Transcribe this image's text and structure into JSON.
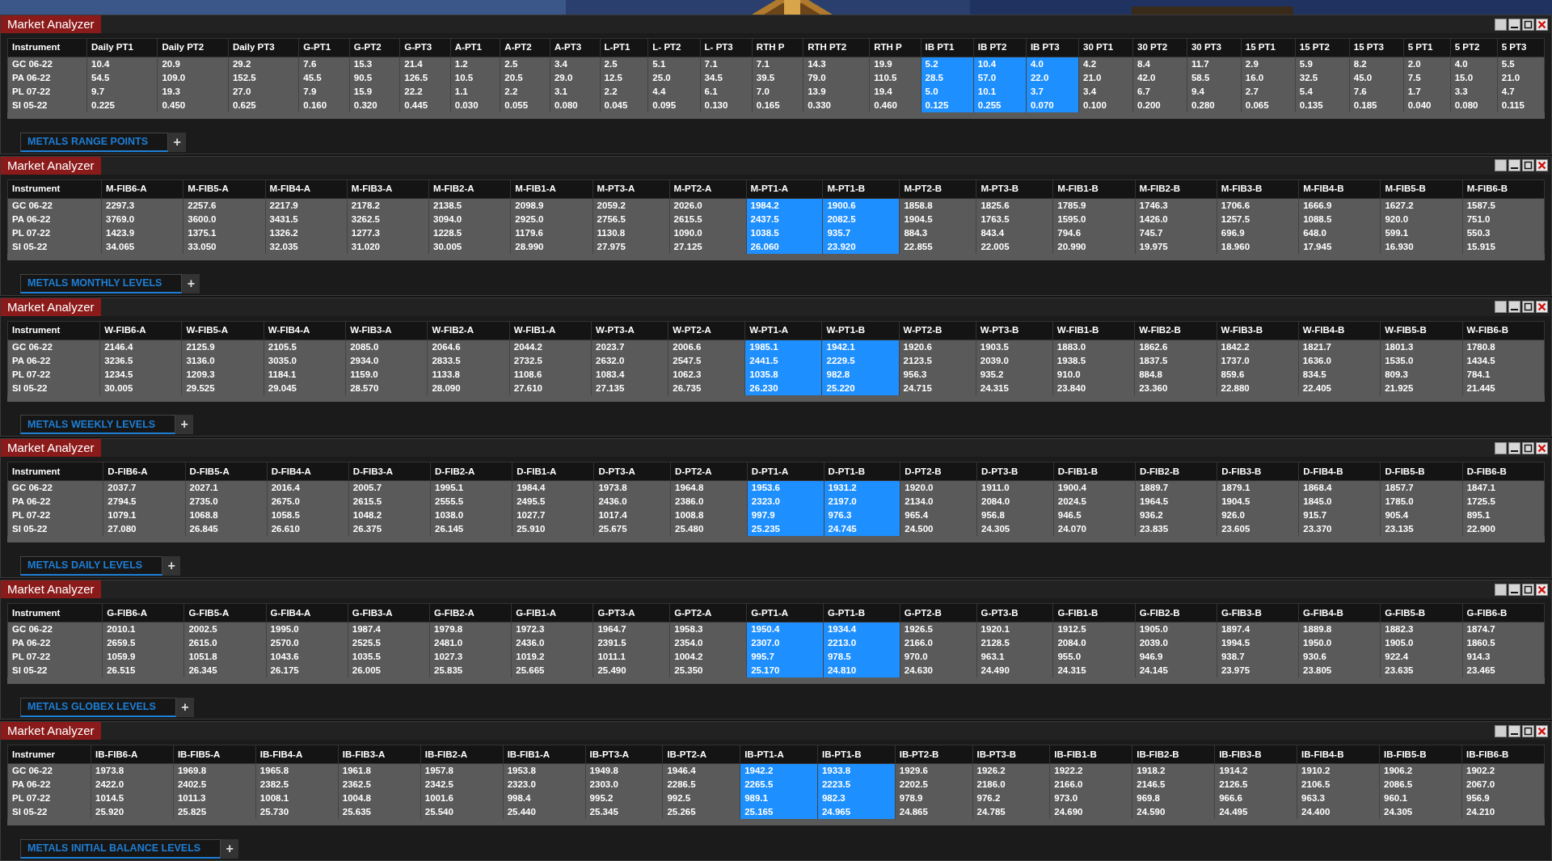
{
  "panels": [
    {
      "title": "Market Analyzer",
      "instrument_header": "Instrument",
      "tab": "METALS RANGE POINTS",
      "add_tab": "+",
      "columns": [
        {
          "label": "Daily PT1",
          "highlighted": false
        },
        {
          "label": "Daily PT2",
          "highlighted": false
        },
        {
          "label": "Daily PT3",
          "highlighted": false
        },
        {
          "label": "G-PT1",
          "highlighted": false
        },
        {
          "label": "G-PT2",
          "highlighted": false
        },
        {
          "label": "G-PT3",
          "highlighted": false
        },
        {
          "label": "A-PT1",
          "highlighted": false
        },
        {
          "label": "A-PT2",
          "highlighted": false
        },
        {
          "label": "A-PT3",
          "highlighted": false
        },
        {
          "label": "L-PT1",
          "highlighted": false
        },
        {
          "label": "L- PT2",
          "highlighted": false
        },
        {
          "label": "L- PT3",
          "highlighted": false
        },
        {
          "label": "RTH P",
          "highlighted": false
        },
        {
          "label": "RTH PT2",
          "highlighted": false
        },
        {
          "label": "RTH P",
          "highlighted": false
        },
        {
          "label": "IB PT1",
          "highlighted": true
        },
        {
          "label": "IB PT2",
          "highlighted": true
        },
        {
          "label": "IB PT3",
          "highlighted": true
        },
        {
          "label": "30 PT1",
          "highlighted": false
        },
        {
          "label": "30 PT2",
          "highlighted": false
        },
        {
          "label": "30 PT3",
          "highlighted": false
        },
        {
          "label": "15 PT1",
          "highlighted": false
        },
        {
          "label": "15 PT2",
          "highlighted": false
        },
        {
          "label": "15 PT3",
          "highlighted": false
        },
        {
          "label": "5 PT1",
          "highlighted": false
        },
        {
          "label": "5 PT2",
          "highlighted": false
        },
        {
          "label": "5 PT3",
          "highlighted": false
        }
      ],
      "rows": [
        {
          "instrument": "GC 06-22",
          "values": [
            "10.4",
            "20.9",
            "29.2",
            "7.6",
            "15.3",
            "21.4",
            "1.2",
            "2.5",
            "3.4",
            "2.5",
            "5.1",
            "7.1",
            "7.1",
            "14.3",
            "19.9",
            "5.2",
            "10.4",
            "4.0",
            "4.2",
            "8.4",
            "11.7",
            "2.9",
            "5.9",
            "8.2",
            "2.0",
            "4.0",
            "5.5"
          ]
        },
        {
          "instrument": "PA 06-22",
          "values": [
            "54.5",
            "109.0",
            "152.5",
            "45.5",
            "90.5",
            "126.5",
            "10.5",
            "20.5",
            "29.0",
            "12.5",
            "25.0",
            "34.5",
            "39.5",
            "79.0",
            "110.5",
            "28.5",
            "57.0",
            "22.0",
            "21.0",
            "42.0",
            "58.5",
            "16.0",
            "32.5",
            "45.0",
            "7.5",
            "15.0",
            "21.0"
          ]
        },
        {
          "instrument": "PL 07-22",
          "values": [
            "9.7",
            "19.3",
            "27.0",
            "7.9",
            "15.9",
            "22.2",
            "1.1",
            "2.2",
            "3.1",
            "2.2",
            "4.4",
            "6.1",
            "7.0",
            "13.9",
            "19.4",
            "5.0",
            "10.1",
            "3.7",
            "3.4",
            "6.7",
            "9.4",
            "2.7",
            "5.4",
            "7.6",
            "1.7",
            "3.3",
            "4.7"
          ]
        },
        {
          "instrument": "SI 05-22",
          "values": [
            "0.225",
            "0.450",
            "0.625",
            "0.160",
            "0.320",
            "0.445",
            "0.030",
            "0.055",
            "0.080",
            "0.045",
            "0.095",
            "0.130",
            "0.165",
            "0.330",
            "0.460",
            "0.125",
            "0.255",
            "0.070",
            "0.100",
            "0.200",
            "0.280",
            "0.065",
            "0.135",
            "0.185",
            "0.040",
            "0.080",
            "0.115"
          ]
        }
      ]
    },
    {
      "title": "Market Analyzer",
      "instrument_header": "Instrument",
      "tab": "METALS MONTHLY LEVELS",
      "add_tab": "+",
      "columns": [
        {
          "label": "M-FIB6-A",
          "highlighted": false
        },
        {
          "label": "M-FIB5-A",
          "highlighted": false
        },
        {
          "label": "M-FIB4-A",
          "highlighted": false
        },
        {
          "label": "M-FIB3-A",
          "highlighted": false
        },
        {
          "label": "M-FIB2-A",
          "highlighted": false
        },
        {
          "label": "M-FIB1-A",
          "highlighted": false
        },
        {
          "label": "M-PT3-A",
          "highlighted": false
        },
        {
          "label": "M-PT2-A",
          "highlighted": false
        },
        {
          "label": "M-PT1-A",
          "highlighted": true
        },
        {
          "label": "M-PT1-B",
          "highlighted": true
        },
        {
          "label": "M-PT2-B",
          "highlighted": false
        },
        {
          "label": "M-PT3-B",
          "highlighted": false
        },
        {
          "label": "M-FIB1-B",
          "highlighted": false
        },
        {
          "label": "M-FIB2-B",
          "highlighted": false
        },
        {
          "label": "M-FIB3-B",
          "highlighted": false
        },
        {
          "label": "M-FIB4-B",
          "highlighted": false
        },
        {
          "label": "M-FIB5-B",
          "highlighted": false
        },
        {
          "label": "M-FIB6-B",
          "highlighted": false
        }
      ],
      "rows": [
        {
          "instrument": "GC 06-22",
          "values": [
            "2297.3",
            "2257.6",
            "2217.9",
            "2178.2",
            "2138.5",
            "2098.9",
            "2059.2",
            "2026.0",
            "1984.2",
            "1900.6",
            "1858.8",
            "1825.6",
            "1785.9",
            "1746.3",
            "1706.6",
            "1666.9",
            "1627.2",
            "1587.5"
          ]
        },
        {
          "instrument": "PA 06-22",
          "values": [
            "3769.0",
            "3600.0",
            "3431.5",
            "3262.5",
            "3094.0",
            "2925.0",
            "2756.5",
            "2615.5",
            "2437.5",
            "2082.5",
            "1904.5",
            "1763.5",
            "1595.0",
            "1426.0",
            "1257.5",
            "1088.5",
            "920.0",
            "751.0"
          ]
        },
        {
          "instrument": "PL 07-22",
          "values": [
            "1423.9",
            "1375.1",
            "1326.2",
            "1277.3",
            "1228.5",
            "1179.6",
            "1130.8",
            "1090.0",
            "1038.5",
            "935.7",
            "884.3",
            "843.4",
            "794.6",
            "745.7",
            "696.9",
            "648.0",
            "599.1",
            "550.3"
          ]
        },
        {
          "instrument": "SI 05-22",
          "values": [
            "34.065",
            "33.050",
            "32.035",
            "31.020",
            "30.005",
            "28.990",
            "27.975",
            "27.125",
            "26.060",
            "23.920",
            "22.855",
            "22.005",
            "20.990",
            "19.975",
            "18.960",
            "17.945",
            "16.930",
            "15.915"
          ]
        }
      ]
    },
    {
      "title": "Market Analyzer",
      "instrument_header": "Instrument",
      "tab": "METALS WEEKLY LEVELS",
      "add_tab": "+",
      "columns": [
        {
          "label": "W-FIB6-A",
          "highlighted": false
        },
        {
          "label": "W-FIB5-A",
          "highlighted": false
        },
        {
          "label": "W-FIB4-A",
          "highlighted": false
        },
        {
          "label": "W-FIB3-A",
          "highlighted": false
        },
        {
          "label": "W-FIB2-A",
          "highlighted": false
        },
        {
          "label": "W-FIB1-A",
          "highlighted": false
        },
        {
          "label": "W-PT3-A",
          "highlighted": false
        },
        {
          "label": "W-PT2-A",
          "highlighted": false
        },
        {
          "label": "W-PT1-A",
          "highlighted": true
        },
        {
          "label": "W-PT1-B",
          "highlighted": true
        },
        {
          "label": "W-PT2-B",
          "highlighted": false
        },
        {
          "label": "W-PT3-B",
          "highlighted": false
        },
        {
          "label": "W-FIB1-B",
          "highlighted": false
        },
        {
          "label": "W-FIB2-B",
          "highlighted": false
        },
        {
          "label": "W-FIB3-B",
          "highlighted": false
        },
        {
          "label": "W-FIB4-B",
          "highlighted": false
        },
        {
          "label": "W-FIB5-B",
          "highlighted": false
        },
        {
          "label": "W-FIB6-B",
          "highlighted": false
        }
      ],
      "rows": [
        {
          "instrument": "GC 06-22",
          "values": [
            "2146.4",
            "2125.9",
            "2105.5",
            "2085.0",
            "2064.6",
            "2044.2",
            "2023.7",
            "2006.6",
            "1985.1",
            "1942.1",
            "1920.6",
            "1903.5",
            "1883.0",
            "1862.6",
            "1842.2",
            "1821.7",
            "1801.3",
            "1780.8"
          ]
        },
        {
          "instrument": "PA 06-22",
          "values": [
            "3236.5",
            "3136.0",
            "3035.0",
            "2934.0",
            "2833.5",
            "2732.5",
            "2632.0",
            "2547.5",
            "2441.5",
            "2229.5",
            "2123.5",
            "2039.0",
            "1938.5",
            "1837.5",
            "1737.0",
            "1636.0",
            "1535.0",
            "1434.5"
          ]
        },
        {
          "instrument": "PL 07-22",
          "values": [
            "1234.5",
            "1209.3",
            "1184.1",
            "1159.0",
            "1133.8",
            "1108.6",
            "1083.4",
            "1062.3",
            "1035.8",
            "982.8",
            "956.3",
            "935.2",
            "910.0",
            "884.8",
            "859.6",
            "834.5",
            "809.3",
            "784.1"
          ]
        },
        {
          "instrument": "SI 05-22",
          "values": [
            "30.005",
            "29.525",
            "29.045",
            "28.570",
            "28.090",
            "27.610",
            "27.135",
            "26.735",
            "26.230",
            "25.220",
            "24.715",
            "24.315",
            "23.840",
            "23.360",
            "22.880",
            "22.405",
            "21.925",
            "21.445"
          ]
        }
      ]
    },
    {
      "title": "Market Analyzer",
      "instrument_header": "Instrument",
      "tab": "METALS DAILY LEVELS",
      "add_tab": "+",
      "columns": [
        {
          "label": "D-FIB6-A",
          "highlighted": false
        },
        {
          "label": "D-FIB5-A",
          "highlighted": false
        },
        {
          "label": "D-FIB4-A",
          "highlighted": false
        },
        {
          "label": "D-FIB3-A",
          "highlighted": false
        },
        {
          "label": "D-FIB2-A",
          "highlighted": false
        },
        {
          "label": "D-FIB1-A",
          "highlighted": false
        },
        {
          "label": "D-PT3-A",
          "highlighted": false
        },
        {
          "label": "D-PT2-A",
          "highlighted": false
        },
        {
          "label": "D-PT1-A",
          "highlighted": true
        },
        {
          "label": "D-PT1-B",
          "highlighted": true
        },
        {
          "label": "D-PT2-B",
          "highlighted": false
        },
        {
          "label": "D-PT3-B",
          "highlighted": false
        },
        {
          "label": "D-FIB1-B",
          "highlighted": false
        },
        {
          "label": "D-FIB2-B",
          "highlighted": false
        },
        {
          "label": "D-FIB3-B",
          "highlighted": false
        },
        {
          "label": "D-FIB4-B",
          "highlighted": false
        },
        {
          "label": "D-FIB5-B",
          "highlighted": false
        },
        {
          "label": "D-FIB6-B",
          "highlighted": false
        }
      ],
      "rows": [
        {
          "instrument": "GC 06-22",
          "values": [
            "2037.7",
            "2027.1",
            "2016.4",
            "2005.7",
            "1995.1",
            "1984.4",
            "1973.8",
            "1964.8",
            "1953.6",
            "1931.2",
            "1920.0",
            "1911.0",
            "1900.4",
            "1889.7",
            "1879.1",
            "1868.4",
            "1857.7",
            "1847.1"
          ]
        },
        {
          "instrument": "PA 06-22",
          "values": [
            "2794.5",
            "2735.0",
            "2675.0",
            "2615.5",
            "2555.5",
            "2495.5",
            "2436.0",
            "2386.0",
            "2323.0",
            "2197.0",
            "2134.0",
            "2084.0",
            "2024.5",
            "1964.5",
            "1904.5",
            "1845.0",
            "1785.0",
            "1725.5"
          ]
        },
        {
          "instrument": "PL 07-22",
          "values": [
            "1079.1",
            "1068.8",
            "1058.5",
            "1048.2",
            "1038.0",
            "1027.7",
            "1017.4",
            "1008.8",
            "997.9",
            "976.3",
            "965.4",
            "956.8",
            "946.5",
            "936.2",
            "926.0",
            "915.7",
            "905.4",
            "895.1"
          ]
        },
        {
          "instrument": "SI 05-22",
          "values": [
            "27.080",
            "26.845",
            "26.610",
            "26.375",
            "26.145",
            "25.910",
            "25.675",
            "25.480",
            "25.235",
            "24.745",
            "24.500",
            "24.305",
            "24.070",
            "23.835",
            "23.605",
            "23.370",
            "23.135",
            "22.900"
          ]
        }
      ]
    },
    {
      "title": "Market Analyzer",
      "instrument_header": "Instrument",
      "tab": "METALS GLOBEX LEVELS",
      "add_tab": "+",
      "columns": [
        {
          "label": "G-FIB6-A",
          "highlighted": false
        },
        {
          "label": "G-FIB5-A",
          "highlighted": false
        },
        {
          "label": "G-FIB4-A",
          "highlighted": false
        },
        {
          "label": "G-FIB3-A",
          "highlighted": false
        },
        {
          "label": "G-FIB2-A",
          "highlighted": false
        },
        {
          "label": "G-FIB1-A",
          "highlighted": false
        },
        {
          "label": "G-PT3-A",
          "highlighted": false
        },
        {
          "label": "G-PT2-A",
          "highlighted": false
        },
        {
          "label": "G-PT1-A",
          "highlighted": true
        },
        {
          "label": "G-PT1-B",
          "highlighted": true
        },
        {
          "label": "G-PT2-B",
          "highlighted": false
        },
        {
          "label": "G-PT3-B",
          "highlighted": false
        },
        {
          "label": "G-FIB1-B",
          "highlighted": false
        },
        {
          "label": "G-FIB2-B",
          "highlighted": false
        },
        {
          "label": "G-FIB3-B",
          "highlighted": false
        },
        {
          "label": "G-FIB4-B",
          "highlighted": false
        },
        {
          "label": "G-FIB5-B",
          "highlighted": false
        },
        {
          "label": "G-FIB6-B",
          "highlighted": false
        }
      ],
      "rows": [
        {
          "instrument": "GC 06-22",
          "values": [
            "2010.1",
            "2002.5",
            "1995.0",
            "1987.4",
            "1979.8",
            "1972.3",
            "1964.7",
            "1958.3",
            "1950.4",
            "1934.4",
            "1926.5",
            "1920.1",
            "1912.5",
            "1905.0",
            "1897.4",
            "1889.8",
            "1882.3",
            "1874.7"
          ]
        },
        {
          "instrument": "PA 06-22",
          "values": [
            "2659.5",
            "2615.0",
            "2570.0",
            "2525.5",
            "2481.0",
            "2436.0",
            "2391.5",
            "2354.0",
            "2307.0",
            "2213.0",
            "2166.0",
            "2128.5",
            "2084.0",
            "2039.0",
            "1994.5",
            "1950.0",
            "1905.0",
            "1860.5"
          ]
        },
        {
          "instrument": "PL 07-22",
          "values": [
            "1059.9",
            "1051.8",
            "1043.6",
            "1035.5",
            "1027.3",
            "1019.2",
            "1011.1",
            "1004.2",
            "995.7",
            "978.5",
            "970.0",
            "963.1",
            "955.0",
            "946.9",
            "938.7",
            "930.6",
            "922.4",
            "914.3"
          ]
        },
        {
          "instrument": "SI 05-22",
          "values": [
            "26.515",
            "26.345",
            "26.175",
            "26.005",
            "25.835",
            "25.665",
            "25.490",
            "25.350",
            "25.170",
            "24.810",
            "24.630",
            "24.490",
            "24.315",
            "24.145",
            "23.975",
            "23.805",
            "23.635",
            "23.465"
          ]
        }
      ]
    },
    {
      "title": "Market Analyzer",
      "instrument_header": "Instrumer",
      "tab": "METALS INITIAL BALANCE LEVELS",
      "add_tab": "+",
      "columns": [
        {
          "label": "IB-FIB6-A",
          "highlighted": false
        },
        {
          "label": "IB-FIB5-A",
          "highlighted": false
        },
        {
          "label": "IB-FIB4-A",
          "highlighted": false
        },
        {
          "label": "IB-FIB3-A",
          "highlighted": false
        },
        {
          "label": "IB-FIB2-A",
          "highlighted": false
        },
        {
          "label": "IB-FIB1-A",
          "highlighted": false
        },
        {
          "label": "IB-PT3-A",
          "highlighted": false
        },
        {
          "label": "IB-PT2-A",
          "highlighted": false
        },
        {
          "label": "IB-PT1-A",
          "highlighted": true
        },
        {
          "label": "IB-PT1-B",
          "highlighted": true
        },
        {
          "label": "IB-PT2-B",
          "highlighted": false
        },
        {
          "label": "IB-PT3-B",
          "highlighted": false
        },
        {
          "label": "IB-FIB1-B",
          "highlighted": false
        },
        {
          "label": "IB-FIB2-B",
          "highlighted": false
        },
        {
          "label": "IB-FIB3-B",
          "highlighted": false
        },
        {
          "label": "IB-FIB4-B",
          "highlighted": false
        },
        {
          "label": "IB-FIB5-B",
          "highlighted": false
        },
        {
          "label": "IB-FIB6-B",
          "highlighted": false
        }
      ],
      "rows": [
        {
          "instrument": "GC 06-22",
          "values": [
            "1973.8",
            "1969.8",
            "1965.8",
            "1961.8",
            "1957.8",
            "1953.8",
            "1949.8",
            "1946.4",
            "1942.2",
            "1933.8",
            "1929.6",
            "1926.2",
            "1922.2",
            "1918.2",
            "1914.2",
            "1910.2",
            "1906.2",
            "1902.2"
          ]
        },
        {
          "instrument": "PA 06-22",
          "values": [
            "2422.0",
            "2402.5",
            "2382.5",
            "2362.5",
            "2342.5",
            "2323.0",
            "2303.0",
            "2286.5",
            "2265.5",
            "2223.5",
            "2202.5",
            "2186.0",
            "2166.0",
            "2146.5",
            "2126.5",
            "2106.5",
            "2086.5",
            "2067.0"
          ]
        },
        {
          "instrument": "PL 07-22",
          "values": [
            "1014.5",
            "1011.3",
            "1008.1",
            "1004.8",
            "1001.6",
            "998.4",
            "995.2",
            "992.5",
            "989.1",
            "982.3",
            "978.9",
            "976.2",
            "973.0",
            "969.8",
            "966.6",
            "963.3",
            "960.1",
            "956.9"
          ]
        },
        {
          "instrument": "SI 05-22",
          "values": [
            "25.920",
            "25.825",
            "25.730",
            "25.635",
            "25.540",
            "25.440",
            "25.345",
            "25.265",
            "25.165",
            "24.965",
            "24.865",
            "24.785",
            "24.690",
            "24.590",
            "24.495",
            "24.400",
            "24.305",
            "24.210"
          ]
        }
      ]
    }
  ]
}
